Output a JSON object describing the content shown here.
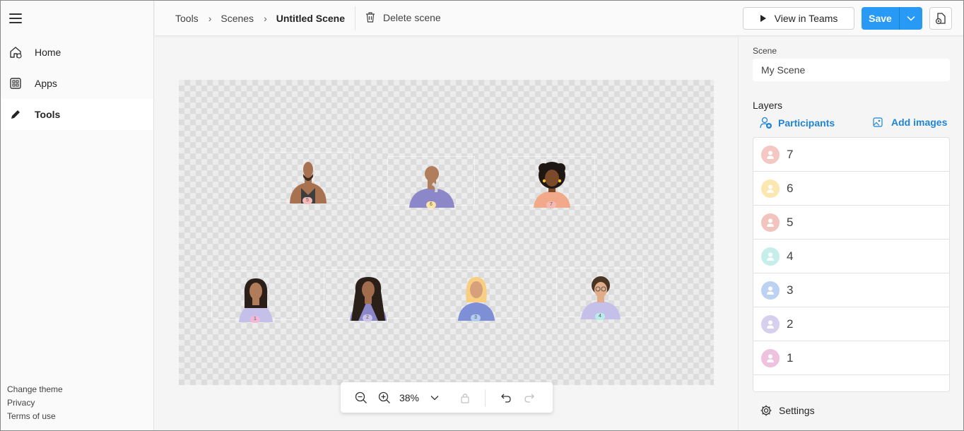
{
  "sidebar": {
    "items": [
      {
        "label": "Home",
        "icon": "home-icon"
      },
      {
        "label": "Apps",
        "icon": "apps-icon"
      },
      {
        "label": "Tools",
        "icon": "pencil-icon",
        "active": true
      }
    ],
    "footer": [
      "Change theme",
      "Privacy",
      "Terms of use"
    ]
  },
  "header": {
    "breadcrumb": [
      "Tools",
      "Scenes",
      "Untitled Scene"
    ],
    "delete_label": "Delete scene",
    "view_label": "View in Teams",
    "save_label": "Save"
  },
  "canvas": {
    "seats": [
      {
        "number": "5",
        "badge_color": "#f4b9b4"
      },
      {
        "number": "6",
        "badge_color": "#fde5a6"
      },
      {
        "number": "7",
        "badge_color": "#f4b9b4"
      },
      {
        "number": "1",
        "badge_color": "#f2b8d8"
      },
      {
        "number": "2",
        "badge_color": "#cbc3ea"
      },
      {
        "number": "3",
        "badge_color": "#b5cdf0"
      },
      {
        "number": "4",
        "badge_color": "#b8ece8"
      }
    ]
  },
  "zoom": {
    "value": "38%"
  },
  "panel": {
    "scene_label": "Scene",
    "scene_value": "My Scene",
    "layers_label": "Layers",
    "participants_label": "Participants",
    "add_images_label": "Add images",
    "layers": [
      {
        "label": "7",
        "color": "#f4c7c3"
      },
      {
        "label": "6",
        "color": "#fde7b0"
      },
      {
        "label": "5",
        "color": "#f2c4bd"
      },
      {
        "label": "4",
        "color": "#c6efec"
      },
      {
        "label": "3",
        "color": "#bcd2f2"
      },
      {
        "label": "2",
        "color": "#d6d0ee"
      },
      {
        "label": "1",
        "color": "#eec2de"
      }
    ],
    "settings_label": "Settings"
  },
  "colors": {
    "accent": "#2899f5",
    "link": "#1f85d4"
  }
}
